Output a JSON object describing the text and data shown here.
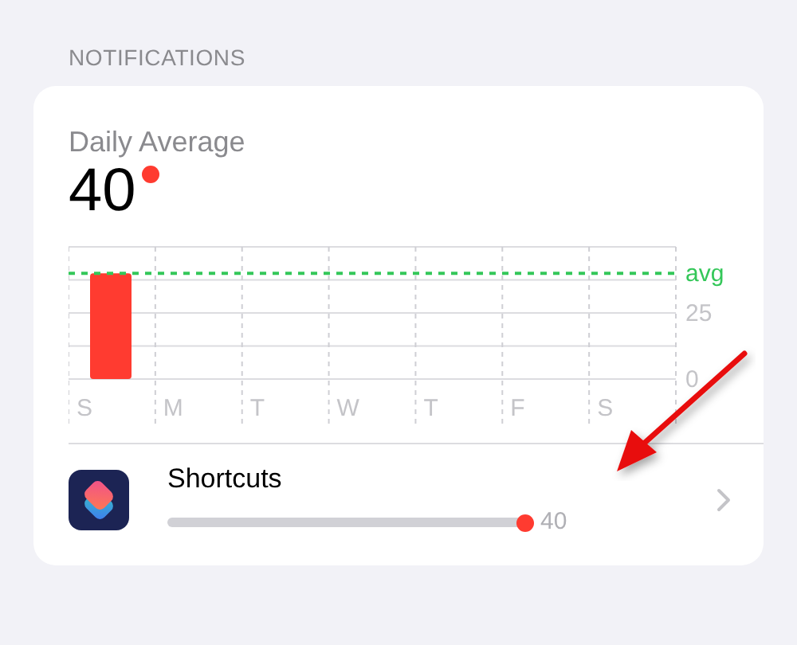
{
  "section_header": "NOTIFICATIONS",
  "card": {
    "title": "Daily Average",
    "value": "40",
    "chart_data": {
      "type": "bar",
      "categories": [
        "S",
        "M",
        "T",
        "W",
        "T",
        "F",
        "S"
      ],
      "series": [
        {
          "color": "#ff3b30",
          "values": [
            40,
            0,
            0,
            0,
            0,
            0,
            0
          ]
        }
      ],
      "ylim": [
        0,
        50
      ],
      "yticks": [
        0,
        25
      ],
      "ref_lines": [
        {
          "axis": "y",
          "value": 40,
          "label": "avg",
          "color": "#34c759"
        }
      ]
    }
  },
  "apps": [
    {
      "name": "Shortcuts",
      "level": 1.0,
      "reading": "40"
    }
  ]
}
